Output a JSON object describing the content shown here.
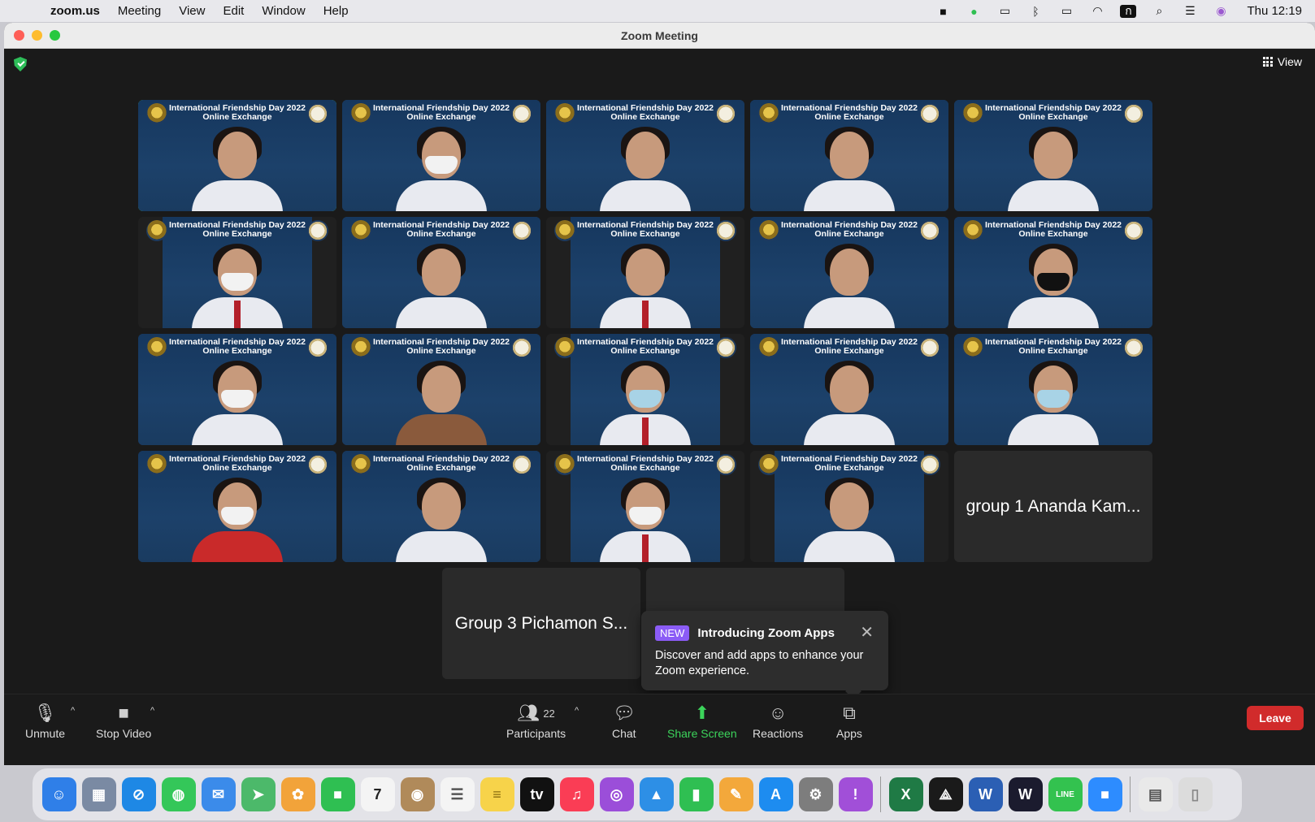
{
  "menubar": {
    "app": "zoom.us",
    "items": [
      "Meeting",
      "View",
      "Edit",
      "Window",
      "Help"
    ],
    "clock": "Thu 12:19",
    "status_icons": [
      "zoom-status-icon",
      "line-status-icon",
      "screens-icon",
      "bluetooth-icon",
      "battery-icon",
      "wifi-icon",
      "input-source-icon",
      "spotlight-icon",
      "control-center-icon",
      "siri-icon"
    ]
  },
  "window": {
    "title": "Zoom Meeting"
  },
  "topbar": {
    "view_label": "View"
  },
  "tiles": [
    {
      "banner": "International Friendship Day 2022\nOnline Exchange",
      "active": true
    },
    {
      "banner": "International Friendship Day 2022\nOnline Exchange"
    },
    {
      "banner": "International Friendship Day 2022\nOnline Exchange"
    },
    {
      "banner": "International Friendship Day 2022\nOnline Exchange"
    },
    {
      "banner": "International Friendship Day 2022\nOnline Exchange"
    },
    {
      "banner": "International Friendship Day 2022\nOnline Exchange"
    },
    {
      "banner": "International Friendship Day 2022\nOnline Exchange"
    },
    {
      "banner": "International Friendship Day 2022\nOnline Exchange"
    },
    {
      "banner": "International Friendship Day 2022\nOnline Exchange"
    },
    {
      "banner": "International Friendship Day 2022\nOnline Exchange"
    },
    {
      "banner": "International Friendship Day 2022\nOnline Exchange"
    },
    {
      "banner": "International Friendship Day 2022\nOnline Exchange"
    },
    {
      "banner": "International Friendship Day 2022\nOnline Exchange"
    },
    {
      "banner": "International Friendship Day 2022\nOnline Exchange"
    },
    {
      "banner": "International Friendship Day 2022\nOnline Exchange"
    },
    {
      "banner": "International Friendship Day 2022\nOnline Exchange"
    },
    {
      "banner": "International Friendship Day 2022\nOnline Exchange"
    },
    {
      "banner": "International Friendship Day 2022\nOnline Exchange"
    },
    {
      "banner": "International Friendship Day 2022\nOnline Exchange"
    }
  ],
  "name_tiles": {
    "group1": "group 1 Ananda Kam...",
    "group3": "Group 3 Pichamon S..."
  },
  "toast": {
    "badge": "NEW",
    "title": "Introducing Zoom Apps",
    "message": "Discover and add apps to enhance your Zoom experience."
  },
  "toolbar": {
    "unmute": "Unmute",
    "stop_video": "Stop Video",
    "participants": "Participants",
    "participants_count": "22",
    "chat": "Chat",
    "share_screen": "Share Screen",
    "reactions": "Reactions",
    "apps": "Apps",
    "leave": "Leave"
  },
  "dock": {
    "apps": [
      {
        "name": "finder",
        "color": "#2f7fe8",
        "glyph": "☺"
      },
      {
        "name": "launchpad",
        "color": "#7a8aa3",
        "glyph": "▦"
      },
      {
        "name": "safari",
        "color": "#1e88e5",
        "glyph": "⊘"
      },
      {
        "name": "messages",
        "color": "#34c759",
        "glyph": "◍"
      },
      {
        "name": "mail",
        "color": "#3b8bea",
        "glyph": "✉"
      },
      {
        "name": "maps",
        "color": "#4cb96a",
        "glyph": "➤"
      },
      {
        "name": "photos",
        "color": "#f2a33a",
        "glyph": "✿"
      },
      {
        "name": "facetime",
        "color": "#2fbf52",
        "glyph": "■"
      },
      {
        "name": "calendar",
        "color": "#f4f4f4",
        "glyph": "7",
        "text": "#222"
      },
      {
        "name": "contacts",
        "color": "#b08a5a",
        "glyph": "◉"
      },
      {
        "name": "reminders",
        "color": "#f4f4f4",
        "glyph": "☰",
        "text": "#555"
      },
      {
        "name": "notes",
        "color": "#f7d34a",
        "glyph": "≡",
        "text": "#8a6d10"
      },
      {
        "name": "apple-tv",
        "color": "#111111",
        "glyph": "tv"
      },
      {
        "name": "music",
        "color": "#fa3d55",
        "glyph": "♫"
      },
      {
        "name": "podcasts",
        "color": "#9b4ed9",
        "glyph": "◎"
      },
      {
        "name": "keynote",
        "color": "#2d8fe6",
        "glyph": "▲"
      },
      {
        "name": "numbers",
        "color": "#2fbf52",
        "glyph": "▮"
      },
      {
        "name": "pages",
        "color": "#f3a83b",
        "glyph": "✎"
      },
      {
        "name": "app-store",
        "color": "#1d8cf0",
        "glyph": "A"
      },
      {
        "name": "system-preferences",
        "color": "#7d7d7d",
        "glyph": "⚙"
      },
      {
        "name": "feedback-assistant",
        "color": "#a14fd8",
        "glyph": "!"
      },
      {
        "name": "excel",
        "color": "#1f7a45",
        "glyph": "X"
      },
      {
        "name": "acrobat",
        "color": "#1a1a1a",
        "glyph": "⟁"
      },
      {
        "name": "word",
        "color": "#2b5fb4",
        "glyph": "W"
      },
      {
        "name": "webex",
        "color": "#1b1b2e",
        "glyph": "W"
      },
      {
        "name": "line",
        "color": "#33c24f",
        "glyph": "LINE"
      },
      {
        "name": "zoom",
        "color": "#2d8cff",
        "glyph": "■"
      },
      {
        "name": "downloads",
        "color": "#e9e9e9",
        "glyph": "▤",
        "text": "#555"
      },
      {
        "name": "trash",
        "color": "#dcdcdc",
        "glyph": "▯",
        "text": "#888"
      }
    ]
  }
}
